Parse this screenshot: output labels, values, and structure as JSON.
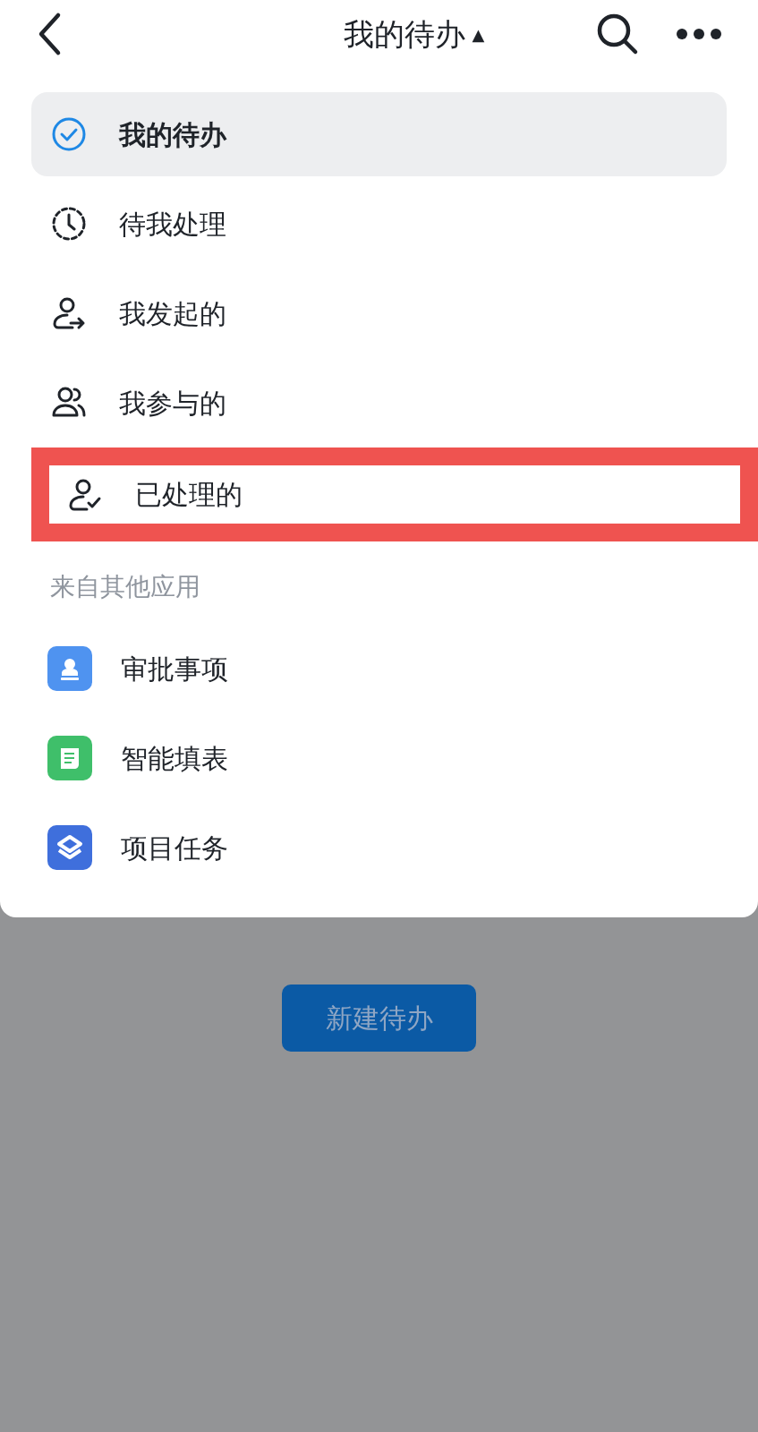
{
  "header": {
    "title": "我的待办",
    "caret": "▲"
  },
  "menu": [
    {
      "kind": "check",
      "label": "我的待办",
      "selected": true,
      "highlighted": false
    },
    {
      "kind": "clock",
      "label": "待我处理",
      "selected": false,
      "highlighted": false
    },
    {
      "kind": "person-out",
      "label": "我发起的",
      "selected": false,
      "highlighted": false
    },
    {
      "kind": "people",
      "label": "我参与的",
      "selected": false,
      "highlighted": false
    },
    {
      "kind": "person-check",
      "label": "已处理的",
      "selected": false,
      "highlighted": true
    }
  ],
  "other_apps": {
    "heading": "来自其他应用",
    "items": [
      {
        "kind": "approval",
        "label": "审批事项",
        "color": "#4f93f0"
      },
      {
        "kind": "form",
        "label": "智能填表",
        "color": "#3fbf6a"
      },
      {
        "kind": "project",
        "label": "项目任务",
        "color": "#3f6fdc"
      }
    ]
  },
  "new_button": "新建待办"
}
